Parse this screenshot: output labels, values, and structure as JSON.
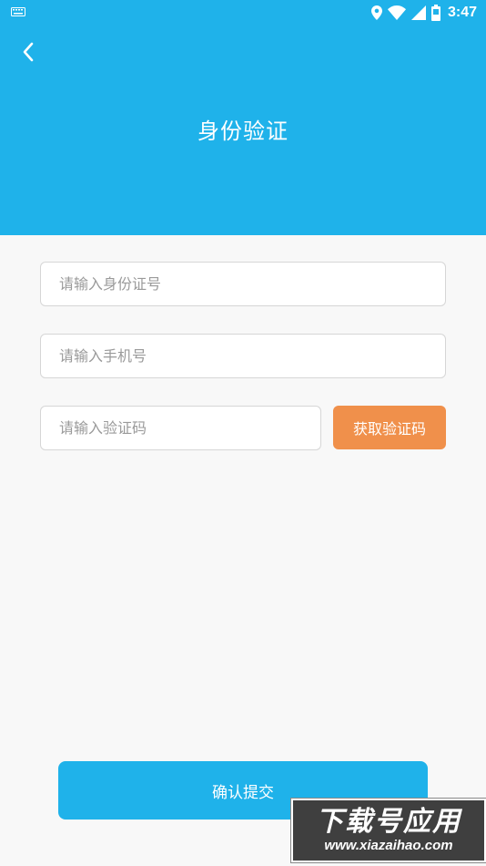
{
  "status_bar": {
    "time": "3:47",
    "icons": [
      "keyboard-icon",
      "location-icon",
      "wifi-icon",
      "signal-icon",
      "battery-icon"
    ]
  },
  "header": {
    "title": "身份验证",
    "back_icon": "chevron-left-icon",
    "color": "#1fb2ea"
  },
  "form": {
    "id_number": {
      "placeholder": "请输入身份证号",
      "value": ""
    },
    "phone": {
      "placeholder": "请输入手机号",
      "value": ""
    },
    "code": {
      "placeholder": "请输入验证码",
      "value": ""
    },
    "get_code_label": "获取验证码",
    "get_code_color": "#f0904b"
  },
  "submit": {
    "label": "确认提交",
    "color": "#1fb2ea"
  },
  "watermark": {
    "main": "下载号应用",
    "sub": "www.xiazaihao.com"
  }
}
